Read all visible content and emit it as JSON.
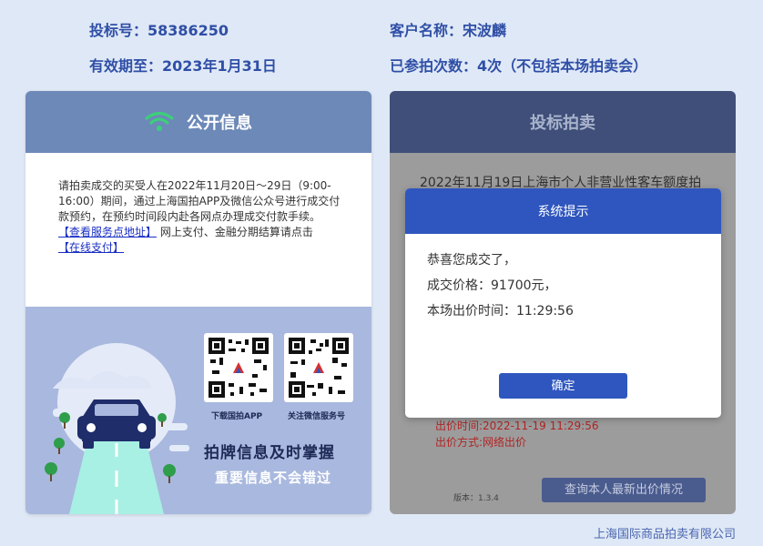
{
  "header": {
    "bid_number": "投标号：58386250",
    "customer_name": "客户名称：宋波麟",
    "valid_until": "有效期至：2023年1月31日",
    "participation_count": "已参拍次数：4次（不包括本场拍卖会）"
  },
  "public_info": {
    "title": "公开信息",
    "paragraph": "请拍卖成交的买受人在2022年11月20日～29日（9:00-16:00）期间，通过上海国拍APP及微信公众号进行成交付款预约，在预约时间段内赴各网点办理成交付款手续。",
    "service_link": "【查看服务点地址】",
    "online_text": " 网上支付、金融分期结算请点击",
    "pay_link": "【在线支付】",
    "qr_app_caption": "下载国拍APP",
    "qr_wechat_caption": "关注微信服务号",
    "slogan_main": "拍牌信息及时掌握",
    "slogan_sub": "重要信息不会错过"
  },
  "bid_auction": {
    "title": "投标拍卖",
    "background_text": "2022年11月19日上海市个人非营业性客车额度拍",
    "bid_time": "出价时间:2022-11-19 11:29:56",
    "bid_method": "出价方式:网络出价",
    "version": "版本：1.3.4",
    "query_button": "查询本人最新出价情况"
  },
  "modal": {
    "title": "系统提示",
    "line1": "恭喜您成交了，",
    "line2": "成交价格：91700元，",
    "line3": "本场出价时间：11:29:56",
    "confirm": "确定"
  },
  "footer": {
    "company": "上海国际商品拍卖有限公司"
  },
  "colors": {
    "page_bg": "#dfe8f6",
    "header_text": "#2f4fa6",
    "left_header": "#6d89b8",
    "right_header": "#3f4f79",
    "modal_primary": "#2f56bf",
    "wifi_icon": "#3ccf7a",
    "red_text": "#b12424"
  }
}
